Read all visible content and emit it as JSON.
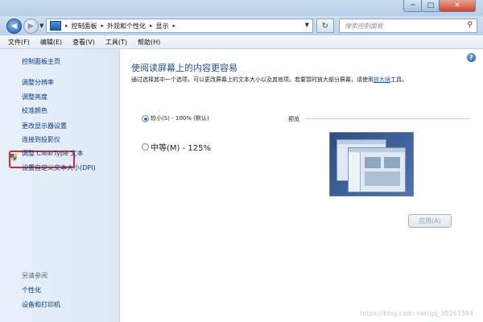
{
  "window": {
    "min_glyph": "─",
    "max_glyph": "□",
    "close_glyph": "✕"
  },
  "address_bar": {
    "back_glyph": "◀",
    "forward_glyph": "▶",
    "breadcrumbs": [
      "控制面板",
      "外观和个性化",
      "显示"
    ],
    "separator": "▸",
    "refresh_glyph": "↻",
    "search_placeholder": "搜索控制面板"
  },
  "menu": {
    "items": [
      "文件(F)",
      "编辑(E)",
      "查看(V)",
      "工具(T)",
      "帮助(H)"
    ]
  },
  "sidebar": {
    "items": [
      {
        "label": "控制面板主页"
      },
      {
        "label": "调整分辨率"
      },
      {
        "label": "调整亮度"
      },
      {
        "label": "校准颜色"
      },
      {
        "label": "更改显示器设置"
      },
      {
        "label": "连接到投影仪"
      },
      {
        "label": "调整 ClearType 文本"
      },
      {
        "label": "设置自定义文本大小(DPI)"
      }
    ],
    "see_also_title": "另请参阅",
    "see_also": [
      {
        "label": "个性化"
      },
      {
        "label": "设备和打印机"
      }
    ]
  },
  "main": {
    "help_glyph": "?",
    "title": "使阅读屏幕上的内容更容易",
    "description_prefix": "通过选择其中一个选项，可以更改屏幕上的文本大小以及其他项。若要暂时放大部分屏幕，请使用",
    "description_link": "放大镜",
    "description_suffix": "工具。",
    "options": [
      {
        "label": "较小(S) - 100% (默认)",
        "selected": true
      },
      {
        "label": "中等(M) - 125%",
        "selected": false
      }
    ],
    "preview_label": "预览",
    "apply_button": "应用(A)"
  },
  "watermark": "https://blog.csdn.net/qq_38161584",
  "colors": {
    "highlight": "#e2262a",
    "link": "#0b3a78",
    "title": "#1f4e8c"
  }
}
